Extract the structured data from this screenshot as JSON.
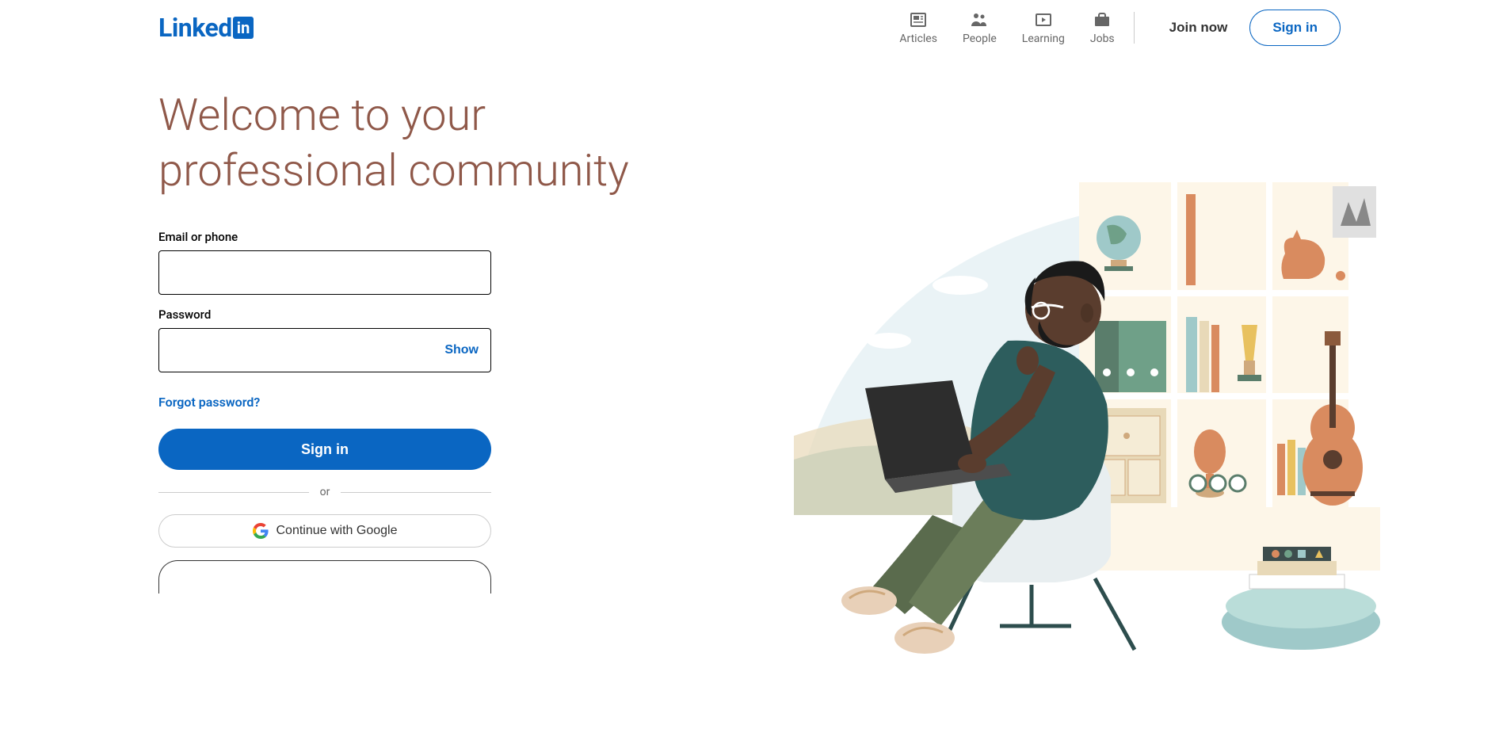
{
  "header": {
    "logo_text": "Linked",
    "logo_badge": "in",
    "nav": [
      {
        "label": "Articles"
      },
      {
        "label": "People"
      },
      {
        "label": "Learning"
      },
      {
        "label": "Jobs"
      }
    ],
    "join_label": "Join now",
    "signin_label": "Sign in"
  },
  "hero": {
    "title": "Welcome to your professional community"
  },
  "form": {
    "email_label": "Email or phone",
    "email_value": "",
    "password_label": "Password",
    "password_value": "",
    "show_label": "Show",
    "forgot_label": "Forgot password?",
    "signin_button": "Sign in",
    "or_text": "or",
    "google_button": "Continue with Google"
  }
}
